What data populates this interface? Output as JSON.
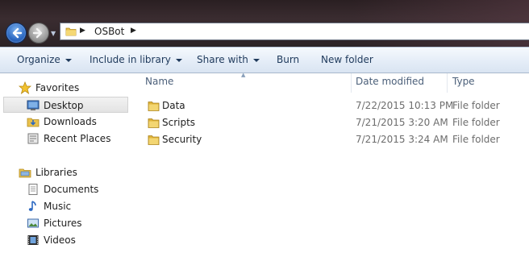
{
  "address": {
    "crumbs": [
      "OSBot"
    ]
  },
  "toolbar": {
    "organize": "Organize",
    "include_in_library": "Include in library",
    "share_with": "Share with",
    "burn": "Burn",
    "new_folder": "New folder"
  },
  "nav": {
    "favorites_header": "Favorites",
    "favorites": [
      {
        "label": "Desktop",
        "icon": "desktop-icon",
        "selected": true
      },
      {
        "label": "Downloads",
        "icon": "downloads-icon"
      },
      {
        "label": "Recent Places",
        "icon": "recent-places-icon"
      }
    ],
    "libraries_header": "Libraries",
    "libraries": [
      {
        "label": "Documents",
        "icon": "documents-icon"
      },
      {
        "label": "Music",
        "icon": "music-icon"
      },
      {
        "label": "Pictures",
        "icon": "pictures-icon"
      },
      {
        "label": "Videos",
        "icon": "videos-icon"
      }
    ]
  },
  "columns": {
    "name": "Name",
    "date_modified": "Date modified",
    "type": "Type"
  },
  "files": [
    {
      "name": "Data",
      "date": "7/22/2015 10:13 PM",
      "type": "File folder"
    },
    {
      "name": "Scripts",
      "date": "7/21/2015 3:20 AM",
      "type": "File folder"
    },
    {
      "name": "Security",
      "date": "7/21/2015 3:24 AM",
      "type": "File folder"
    }
  ],
  "colors": {
    "toolbar_text": "#1e395b",
    "header_text": "#4c607a",
    "folder_yellow": "#e9c14d",
    "titlebar_dark": "#2a1f22"
  }
}
